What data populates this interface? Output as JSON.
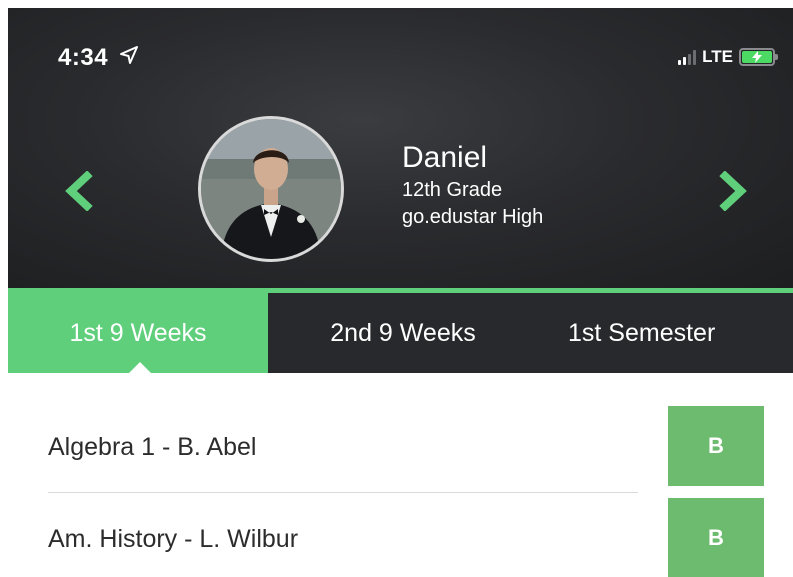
{
  "status_bar": {
    "time": "4:34",
    "network": "LTE",
    "location_icon": "location-arrow-icon",
    "signal_icon": "signal-bars-icon",
    "battery_icon": "battery-charging-icon"
  },
  "student": {
    "name": "Daniel",
    "grade": "12th Grade",
    "school": "go.edustar High",
    "prev_icon": "chevron-left-icon",
    "next_icon": "chevron-right-icon"
  },
  "tabs": [
    {
      "label": "1st 9 Weeks",
      "active": true
    },
    {
      "label": "2nd 9 Weeks",
      "active": false
    },
    {
      "label": "1st Semester",
      "active": false
    }
  ],
  "courses": [
    {
      "name": "Algebra 1 - B. Abel",
      "grade": "B"
    },
    {
      "name": "Am. History - L. Wilbur",
      "grade": "B"
    }
  ],
  "colors": {
    "accent_green": "#5fcf7b",
    "grade_green": "#6cbb6e",
    "header_dark": "#28292c"
  }
}
